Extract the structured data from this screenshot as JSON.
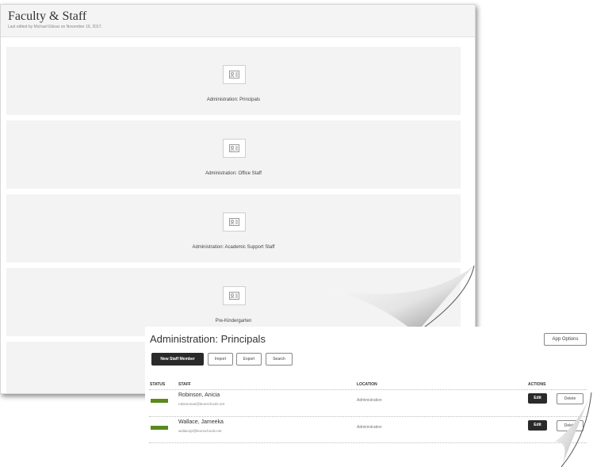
{
  "back_page": {
    "title": "Faculty & Staff",
    "subtitle": "Last edited by Michael Ebisar on November 16, 2017.",
    "cards": [
      {
        "label": "Administration: Principals"
      },
      {
        "label": "Administration: Office Staff"
      },
      {
        "label": "Administration: Academic Support Staff"
      },
      {
        "label": "Pre-Kindergarten"
      }
    ]
  },
  "front_page": {
    "title": "Administration: Principals",
    "app_options": "App Options",
    "toolbar": {
      "new_staff": "New Staff Member",
      "import": "Import",
      "export": "Export",
      "search": "Search"
    },
    "columns": {
      "status": "STATUS",
      "staff": "STAFF",
      "location": "LOCATION",
      "actions": "ACTIONS"
    },
    "rows": [
      {
        "name": "Robinson, Anicia",
        "email": "robinsona2@leonschools.net",
        "location": "Administration",
        "edit": "Edit",
        "delete": "Delete"
      },
      {
        "name": "Wallace, Jameeka",
        "email": "wallacej2@leonschools.net",
        "location": "Administration",
        "edit": "Edit",
        "delete": "Delete"
      }
    ]
  },
  "colors": {
    "status_active": "#5a8a1e",
    "dark_button": "#2a2a2a"
  },
  "icons": {
    "card_icon": "contact-card-icon"
  }
}
